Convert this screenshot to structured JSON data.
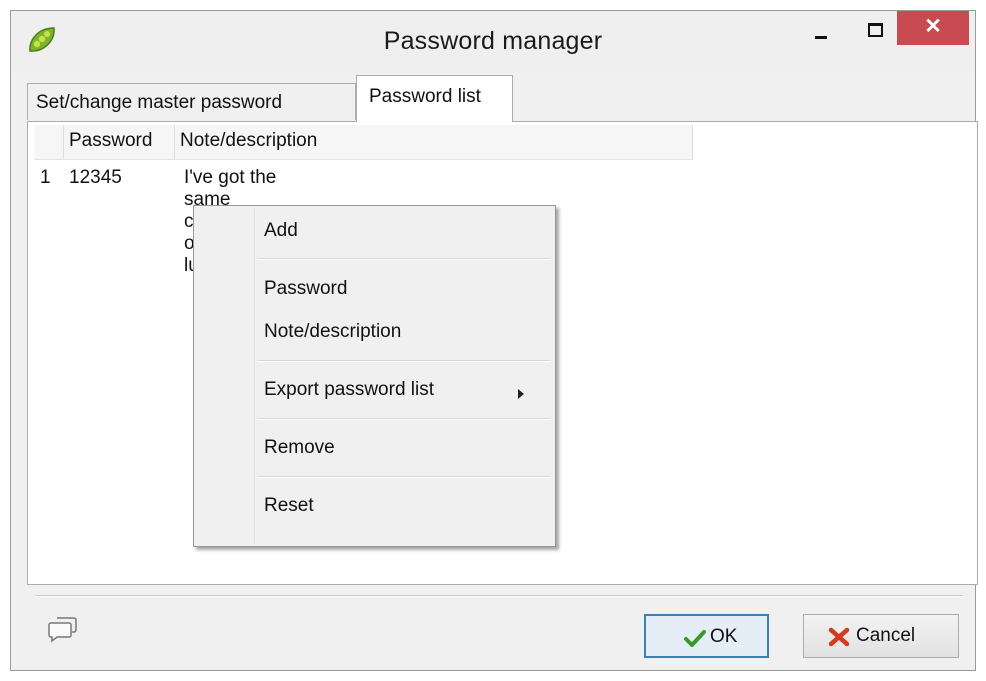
{
  "window": {
    "title": "Password manager",
    "close_glyph": "✕"
  },
  "tabs": [
    {
      "label": "Set/change master password",
      "selected": false
    },
    {
      "label": "Password list",
      "selected": true
    }
  ],
  "table": {
    "columns": [
      "Password",
      "Note/description"
    ],
    "rows": [
      {
        "index": "1",
        "password": "12345",
        "note": "I've got the same combination on my luggage!"
      }
    ]
  },
  "context_menu": {
    "items": [
      {
        "label": "Add"
      },
      {
        "label": "Password"
      },
      {
        "label": "Note/description"
      },
      {
        "label": "Export password list",
        "has_submenu": true
      },
      {
        "label": "Remove"
      },
      {
        "label": "Reset"
      }
    ]
  },
  "footer": {
    "ok_label": "OK",
    "cancel_label": "Cancel"
  },
  "icons": {
    "app": "pea-pod-icon",
    "notes": "speech-bubbles-icon",
    "ok": "checkmark-icon",
    "cancel": "red-x-icon"
  },
  "colors": {
    "close_button": "#c74b50",
    "ok_border": "#3c7fb1",
    "ok_check": "#3b9a27",
    "cancel_x": "#d43a1d"
  }
}
